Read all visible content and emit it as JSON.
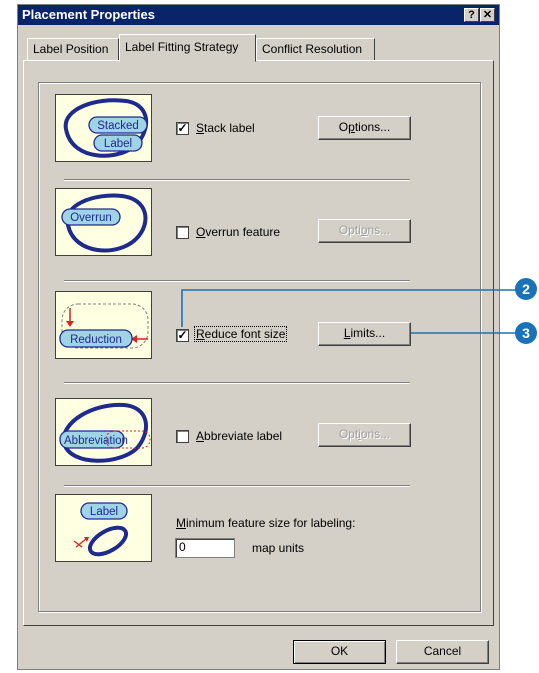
{
  "window": {
    "title": "Placement Properties",
    "help_glyph": "?",
    "close_glyph": "✕"
  },
  "tabs": [
    {
      "label": "Label Position",
      "active": false
    },
    {
      "label": "Label Fitting Strategy",
      "active": true
    },
    {
      "label": "Conflict Resolution",
      "active": false
    }
  ],
  "options": {
    "stack": {
      "thumb_words": [
        "Stacked",
        "Label"
      ],
      "checked": true,
      "label_key": "S",
      "label_rest": "tack label",
      "button_key": "p",
      "button_pre": "O",
      "button_rest": "tions...",
      "button_enabled": true
    },
    "overrun": {
      "thumb_words": [
        "Overrun"
      ],
      "checked": false,
      "label_key": "O",
      "label_rest": "verrun feature",
      "button_pre": "Opti",
      "button_key": "o",
      "button_rest": "ns...",
      "button_enabled": false
    },
    "reduce": {
      "thumb_words": [
        "Reduction"
      ],
      "checked": true,
      "label_key": "R",
      "label_rest": "educe font size",
      "button_key": "L",
      "button_pre": "",
      "button_rest": "imits...",
      "button_enabled": true
    },
    "abbreviate": {
      "thumb_words": [
        "Abbreviation"
      ],
      "checked": false,
      "label_key": "A",
      "label_rest": "bbreviate label",
      "button_pre": "Opt",
      "button_key": "i",
      "button_rest": "ons...",
      "button_enabled": false
    }
  },
  "min_size": {
    "thumb_word": "Label",
    "label_key": "M",
    "label_rest": "inimum feature size for labeling:",
    "value": "0",
    "units": "map units"
  },
  "footer": {
    "ok": "OK",
    "cancel": "Cancel"
  },
  "callouts": [
    "2",
    "3"
  ],
  "colors": {
    "titlebar": "#0a246a",
    "dialog": "#d4d0c8",
    "thumb_bg": "#ffffe1",
    "ellipse": "#1f2a8f",
    "label_fill": "#9fd3e6",
    "callout": "#1a73b8",
    "arrow": "#e02020"
  }
}
